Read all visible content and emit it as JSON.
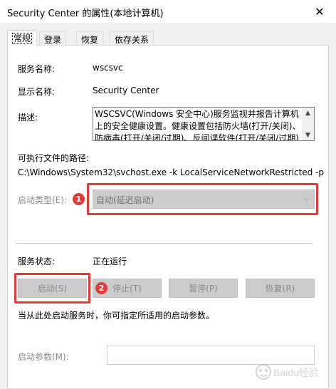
{
  "window": {
    "title": "Security Center 的属性(本地计算机)"
  },
  "tabs": [
    {
      "label": "常规",
      "active": true
    },
    {
      "label": "登录",
      "active": false
    },
    {
      "label": "恢复",
      "active": false
    },
    {
      "label": "依存关系",
      "active": false
    }
  ],
  "general": {
    "service_name_label": "服务名称:",
    "service_name": "wscsvc",
    "display_name_label": "显示名称:",
    "display_name": "Security Center",
    "description_label": "描述:",
    "description": "WSCSVC(Windows 安全中心)服务监视并报告计算机上的安全健康设置。健康设置包括防火墙(打开/关闭)、防病毒(打开/关闭/过期)、反间谍软件(打开/关闭/过期)",
    "exe_path_label": "可执行文件的路径:",
    "exe_path": "C:\\Windows\\System32\\svchost.exe -k LocalServiceNetworkRestricted -p",
    "startup_type_label": "启动类型(E):",
    "startup_type_value": "自动(延迟启动)",
    "service_status_label": "服务状态:",
    "service_status": "正在运行",
    "buttons": {
      "start": "启动(S)",
      "stop": "停止(T)",
      "pause": "暂停(P)",
      "resume": "恢复(R)"
    },
    "start_params_hint": "当从此处启动服务时，你可指定所适用的启动参数。",
    "start_params_label": "启动参数(M):",
    "start_params_value": ""
  },
  "annotations": {
    "badge1": "1",
    "badge2": "2",
    "color": "#e23b3b"
  },
  "watermark_text": "Baidu经验"
}
